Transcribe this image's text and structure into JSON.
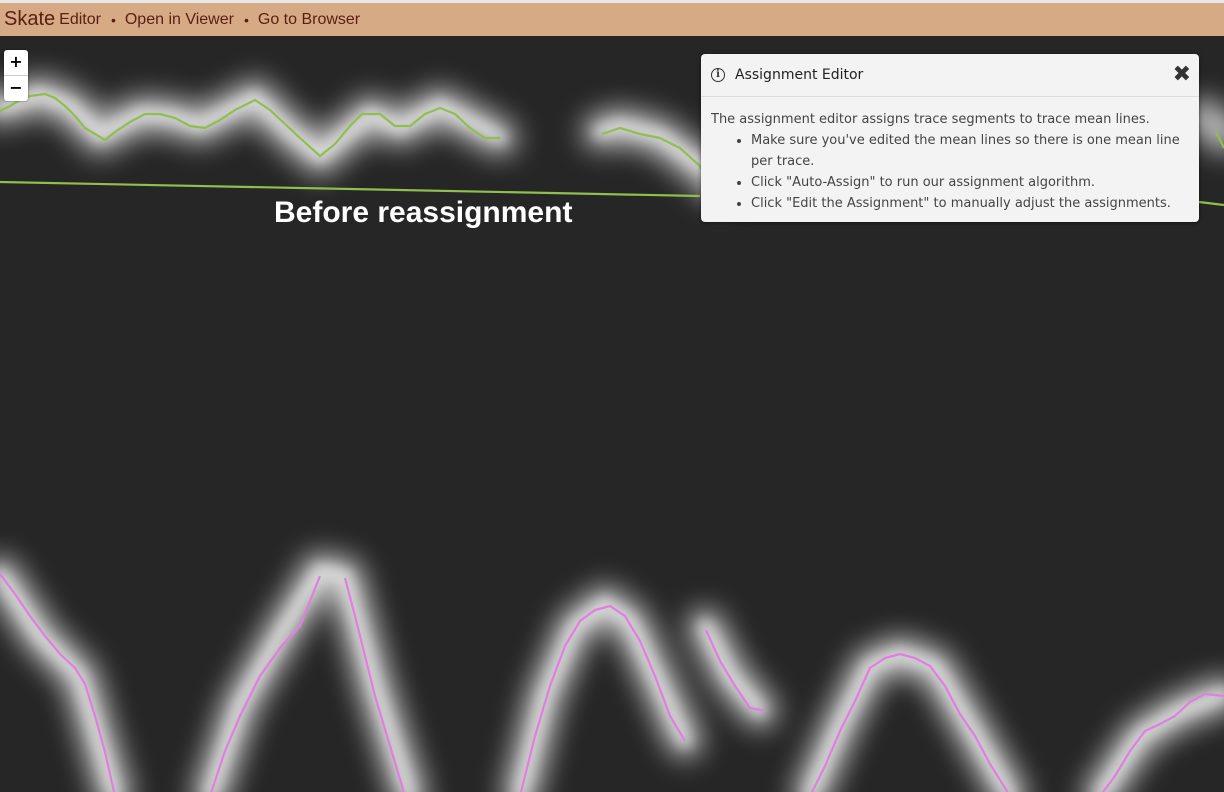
{
  "header": {
    "brand": "Skate",
    "brand_sub": "Editor",
    "separator": "•",
    "links": [
      "Open in Viewer",
      "Go to Browser"
    ]
  },
  "map": {
    "zoom_in": "+",
    "zoom_out": "−",
    "overlay_label": "Before reassignment",
    "colors": {
      "background": "#262626",
      "trace_glow": "#ffffff",
      "upper_trace_line": "#8fbf4e",
      "lower_trace_line": "#e07fe0"
    }
  },
  "panel": {
    "icon": "info-icon",
    "title": "Assignment Editor",
    "close_icon": "close-icon",
    "intro": "The assignment editor assigns trace segments to trace mean lines.",
    "bullets": [
      "Make sure you've edited the mean lines so there is one mean line per trace.",
      "Click \"Auto-Assign\" to run our assignment algorithm.",
      "Click \"Edit the Assignment\" to manually adjust the assignments."
    ]
  }
}
